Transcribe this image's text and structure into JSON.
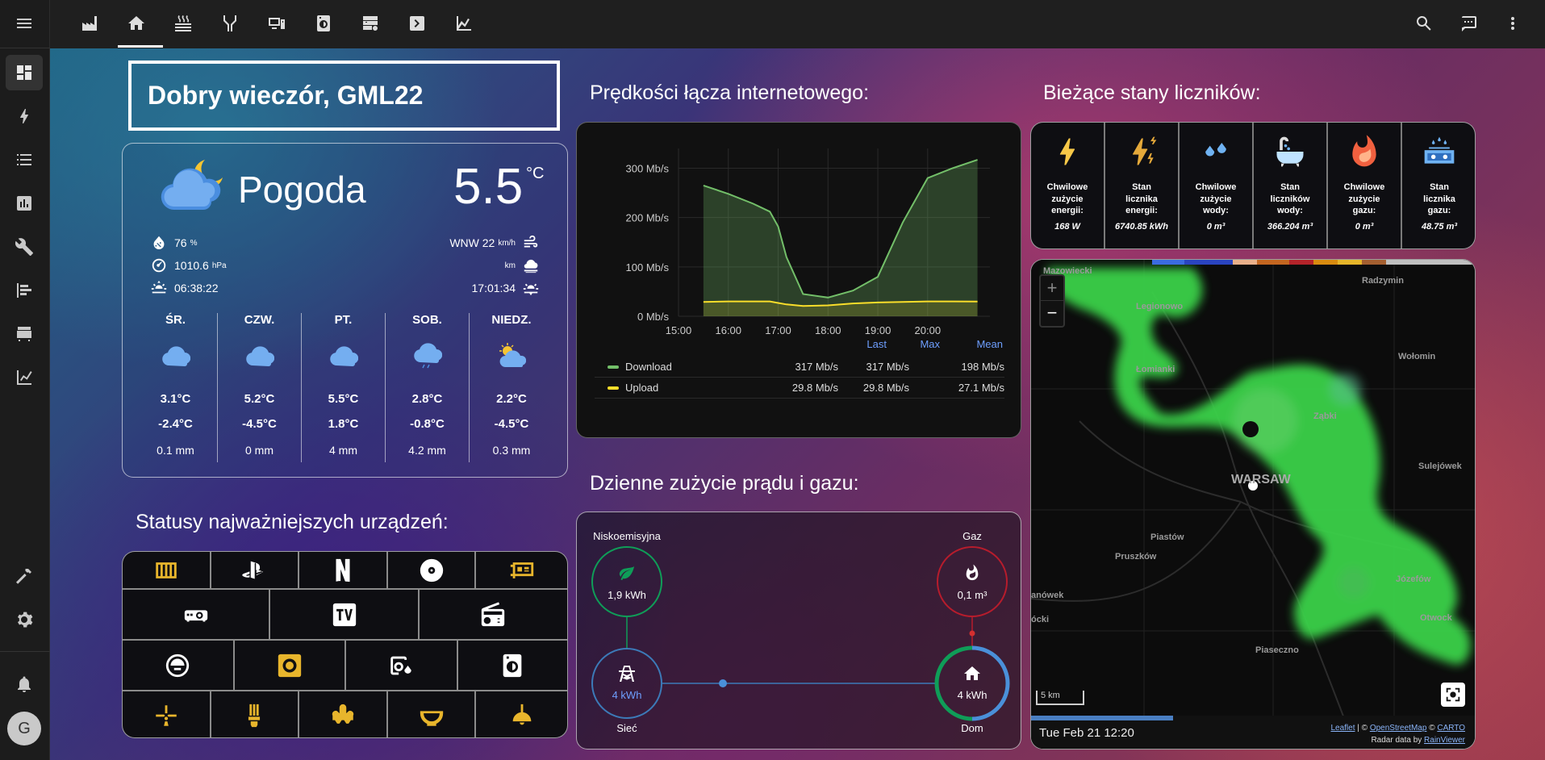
{
  "sidebar": {
    "items": [
      {
        "icon": "dashboard-icon"
      },
      {
        "icon": "lightning-icon"
      },
      {
        "icon": "list-icon"
      },
      {
        "icon": "bar-chart-icon"
      },
      {
        "icon": "wrench-icon"
      },
      {
        "icon": "history-icon"
      },
      {
        "icon": "hacs-icon"
      },
      {
        "icon": "chart-line-icon"
      }
    ],
    "bottom": [
      {
        "icon": "hammer-icon"
      },
      {
        "icon": "settings-icon"
      },
      {
        "icon": "bell-icon"
      }
    ],
    "avatar": "G"
  },
  "topbar": {
    "tabs": [
      "factory-icon",
      "home-icon",
      "radiator-icon",
      "network-icon",
      "monitor-speaker-icon",
      "washing-machine-icon",
      "server-icon",
      "chevron-right-box-icon",
      "chart-bell-icon"
    ],
    "actions": [
      "search-icon",
      "chat-icon",
      "more-icon"
    ]
  },
  "greeting": "Dobry wieczór, GML22",
  "weather": {
    "title": "Pogoda",
    "temp": "5.5",
    "temp_unit": "°C",
    "humidity": "76",
    "humidity_unit": "%",
    "pressure": "1010.6",
    "pressure_unit": "hPa",
    "sunrise": "06:38:22",
    "wind": "WNW 22",
    "wind_unit": "km/h",
    "visibility_unit": "km",
    "sunset": "17:01:34",
    "forecast": [
      {
        "day": "ŚR.",
        "icon": "cloudy",
        "high": "3.1°C",
        "low": "-2.4°C",
        "precip": "0.1 mm"
      },
      {
        "day": "CZW.",
        "icon": "cloudy",
        "high": "5.2°C",
        "low": "-4.5°C",
        "precip": "0 mm"
      },
      {
        "day": "PT.",
        "icon": "cloudy",
        "high": "5.5°C",
        "low": "1.8°C",
        "precip": "4 mm"
      },
      {
        "day": "SOB.",
        "icon": "rainy",
        "high": "2.8°C",
        "low": "-0.8°C",
        "precip": "4.2 mm"
      },
      {
        "day": "NIEDZ.",
        "icon": "partly-sunny",
        "high": "2.2°C",
        "low": "-4.5°C",
        "precip": "0.3 mm"
      }
    ]
  },
  "devices_title": "Statusy najważniejszych urządzeń:",
  "speed": {
    "title": "Prędkości łącza internetowego:",
    "col_last": "Last",
    "col_max": "Max",
    "col_mean": "Mean",
    "download_label": "Download",
    "download_last": "317 Mb/s",
    "download_max": "317 Mb/s",
    "download_mean": "198 Mb/s",
    "upload_label": "Upload",
    "upload_last": "29.8 Mb/s",
    "upload_max": "29.8 Mb/s",
    "upload_mean": "27.1 Mb/s",
    "colors": {
      "download": "#73bf69",
      "upload": "#fade2a"
    }
  },
  "chart_data": {
    "type": "area",
    "x": [
      "15:30",
      "16:00",
      "16:30",
      "16:50",
      "17:00",
      "17:10",
      "17:30",
      "18:00",
      "18:30",
      "19:00",
      "19:30",
      "20:00",
      "20:30",
      "21:00"
    ],
    "xticks": [
      "15:00",
      "16:00",
      "17:00",
      "18:00",
      "19:00",
      "20:00"
    ],
    "yticks": [
      "0 Mb/s",
      "100 Mb/s",
      "200 Mb/s",
      "300 Mb/s"
    ],
    "ylim": [
      0,
      340
    ],
    "series": [
      {
        "name": "Download",
        "values": [
          265,
          248,
          228,
          212,
          182,
          120,
          45,
          38,
          52,
          80,
          190,
          280,
          300,
          317
        ]
      },
      {
        "name": "Upload",
        "values": [
          29,
          30,
          30,
          30,
          27,
          24,
          21,
          22,
          26,
          28,
          29,
          30,
          30,
          29.8
        ]
      }
    ]
  },
  "energy": {
    "title": "Dzienne zużycie prądu i gazu:",
    "lowcarbon_label": "Niskoemisyjna",
    "lowcarbon_value": "1,9 kWh",
    "gas_label": "Gaz",
    "gas_value": "0,1 m³",
    "grid_label": "Sieć",
    "grid_value": "4 kWh",
    "home_label": "Dom",
    "home_value": "4 kWh"
  },
  "meters": {
    "title": "Bieżące stany liczników:",
    "items": [
      {
        "icon": "lightning-icon",
        "label": [
          "Chwilowe",
          "zużycie",
          "energii:"
        ],
        "value": "168 W"
      },
      {
        "icon": "lightning-meter-icon",
        "label": [
          "Stan",
          "licznika",
          "energii:"
        ],
        "value": "6740.85 kWh"
      },
      {
        "icon": "water-drops-icon",
        "label": [
          "Chwilowe",
          "zużycie",
          "wody:"
        ],
        "value": "0 m³"
      },
      {
        "icon": "bathtub-icon",
        "label": [
          "Stan",
          "liczników",
          "wody:"
        ],
        "value": "366.204 m³"
      },
      {
        "icon": "fire-icon",
        "label": [
          "Chwilowe",
          "zużycie",
          "gazu:"
        ],
        "value": "0 m³"
      },
      {
        "icon": "gas-stove-icon",
        "label": [
          "Stan",
          "licznika",
          "gazu:"
        ],
        "value": "48.75 m³"
      }
    ]
  },
  "map": {
    "cities": [
      "Mazowiecki",
      "Radzymin",
      "Legionowo",
      "Wołomin",
      "Łomianki",
      "Ząbki",
      "Sulejówek",
      "WARSAW",
      "Piastów",
      "Pruszków",
      "Józefów",
      "Otwock",
      "anówek",
      "ócki",
      "Piaseczno"
    ],
    "scale": "5 km",
    "timestamp": "Tue Feb 21 12:20",
    "attr_leaflet": "Leaflet",
    "attr_sep1": " | © ",
    "attr_osm": "OpenStreetMap",
    "attr_sep2": " © ",
    "attr_carto": "CARTO",
    "attr_radar": "Radar data by ",
    "attr_rainviewer": "RainViewer",
    "zoom_in": "+",
    "zoom_out": "−"
  }
}
